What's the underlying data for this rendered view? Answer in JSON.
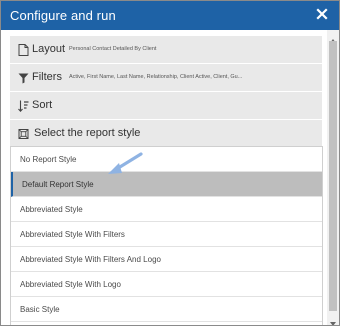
{
  "dialog": {
    "title": "Configure and run"
  },
  "sections": {
    "layout": {
      "label": "Layout",
      "summary": "Personal Contact Detailed By Client"
    },
    "filters": {
      "label": "Filters",
      "summary": "Active, First Name, Last Name, Relationship, Client Active, Client, Gu..."
    },
    "sort": {
      "label": "Sort"
    },
    "report_style": {
      "label": "Select the report style"
    }
  },
  "report_styles": [
    {
      "label": "No Report Style"
    },
    {
      "label": "Default Report Style",
      "selected": true
    },
    {
      "label": "Abbreviated Style"
    },
    {
      "label": "Abbreviated Style With Filters"
    },
    {
      "label": "Abbreviated Style With Filters And Logo"
    },
    {
      "label": "Abbreviated Style With Logo"
    },
    {
      "label": "Basic Style"
    }
  ],
  "icons": {
    "close": "close-icon",
    "layout": "document-icon",
    "filters": "filter-icon",
    "sort": "sort-icon",
    "report_style": "frame-icon"
  },
  "colors": {
    "titlebar": "#1e62a6",
    "section_bg": "#e9e9e9",
    "selected_bg": "#bdbdbd",
    "arrow": "#8fb3e3"
  }
}
